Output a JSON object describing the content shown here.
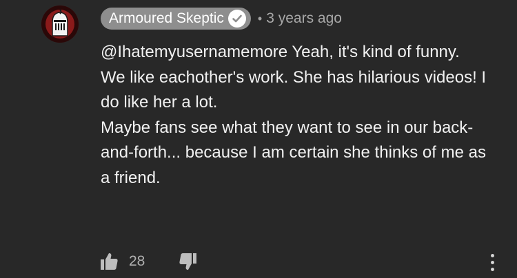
{
  "comment": {
    "author": "Armoured Skeptic",
    "author_verified": true,
    "separator": "•",
    "timestamp": "3 years ago",
    "lines": [
      "@Ihatemyusernamemore Yeah, it's kind of funny.",
      "We like eachother's work. She has hilarious videos! I do like her a lot.",
      "Maybe fans see what they want to see in our back-and-forth... because I am certain she thinks of me as a friend."
    ],
    "like_count": "28"
  },
  "icons": {
    "avatar": "knight-helmet-avatar",
    "verified": "checkmark-icon",
    "like": "thumbs-up-icon",
    "dislike": "thumbs-down-icon",
    "more": "vertical-ellipsis-icon"
  },
  "colors": {
    "background": "#282828",
    "author_pill": "#8e8e8e",
    "text": "#f1f1f1",
    "muted_text": "#a8a8a8"
  }
}
